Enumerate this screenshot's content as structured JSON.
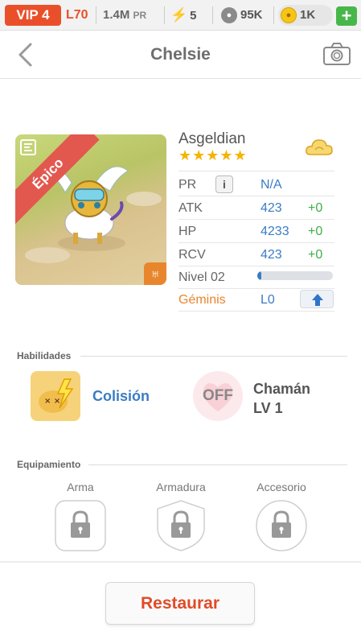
{
  "status_bar": {
    "vip": "VIP 4",
    "level": "L70",
    "power": "1.4M",
    "power_unit": "PR",
    "energy": "5",
    "paws": "95K",
    "coins": "1K",
    "add": "+"
  },
  "header": {
    "title": "Chelsie"
  },
  "card": {
    "rarity": "Épico",
    "sign_icon": "♅"
  },
  "monster": {
    "name": "Asgeldian",
    "stars": "★★★★★",
    "stats": [
      {
        "label": "PR",
        "value": "N/A"
      },
      {
        "label": "ATK",
        "value": "423",
        "bonus": "+0"
      },
      {
        "label": "HP",
        "value": "4233",
        "bonus": "+0"
      },
      {
        "label": "RCV",
        "value": "423",
        "bonus": "+0"
      },
      {
        "label": "Nivel 02"
      },
      {
        "label": "Géminis",
        "value": "L0"
      }
    ],
    "level_progress": 0.05,
    "info_label": "i"
  },
  "skills": {
    "title": "Habilidades",
    "active_name": "Colisión",
    "off_label": "OFF",
    "passive_name": "Chamán",
    "passive_level": "LV 1"
  },
  "equipment": {
    "title": "Equipamiento",
    "slots": [
      "Arma",
      "Armadura",
      "Accesorio"
    ]
  },
  "footer": {
    "restore_label": "Restaurar"
  },
  "colors": {
    "accent": "#e14b28",
    "value_blue": "#3a7cc3",
    "bonus_green": "#3fae49",
    "element_orange": "#e8862d",
    "star": "#f4b400"
  }
}
